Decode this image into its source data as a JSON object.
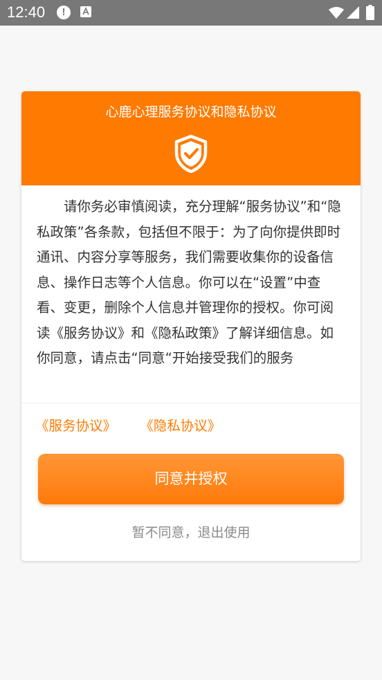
{
  "status_bar": {
    "time": "12:40",
    "alert_icon": "!"
  },
  "dialog": {
    "title": "心鹿心理服务协议和隐私协议",
    "icon": "shield-check-icon",
    "body": "请你务必审慎阅读，充分理解“服务协议”和“隐私政策”各条款，包括但不限于：为了向你提供即时通讯、内容分享等服务，我们需要收集你的设备信息、操作日志等个人信息。你可以在“设置”中查看、变更，删除个人信息并管理你的授权。你可阅读《服务协议》和《隐私政策》了解详细信息。如你同意，请点击“同意“开始接受我们的服务",
    "links": {
      "service_agreement": "《服务协议》",
      "privacy_agreement": "《隐私协议》"
    },
    "agree_button": "同意并授权",
    "disagree_link": "暂不同意，退出使用"
  },
  "colors": {
    "accent": "#ff7a00",
    "status_bar": "#787878",
    "background": "#f7f7f7",
    "body_text": "#333333",
    "muted_text": "#8a8a8a"
  }
}
